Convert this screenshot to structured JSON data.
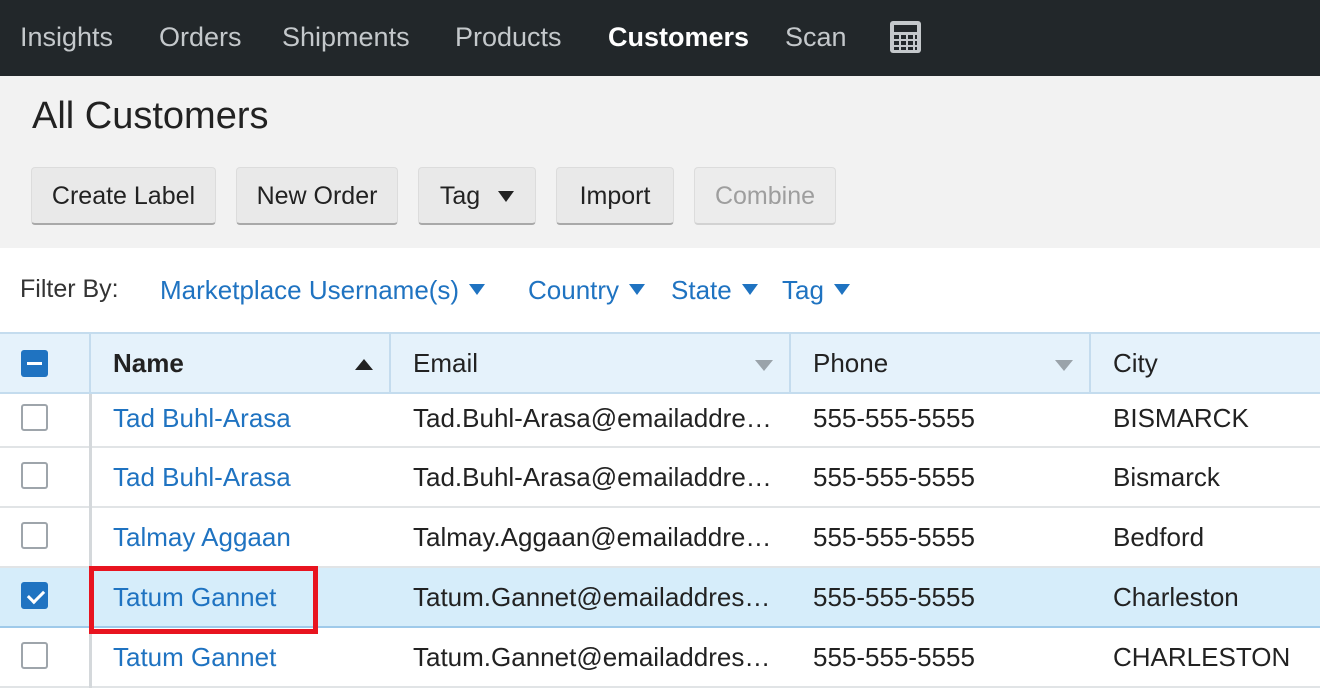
{
  "nav": {
    "items": [
      "Insights",
      "Orders",
      "Shipments",
      "Products",
      "Customers",
      "Scan"
    ],
    "active": "Customers",
    "calculator_icon": "calculator-icon"
  },
  "page": {
    "title": "All Customers"
  },
  "toolbar": {
    "create_label": "Create Label",
    "new_order": "New Order",
    "tag": "Tag",
    "import": "Import",
    "combine": "Combine"
  },
  "filters": {
    "label": "Filter By:",
    "items": [
      "Marketplace Username(s)",
      "Country",
      "State",
      "Tag"
    ]
  },
  "table": {
    "columns": [
      "Name",
      "Email",
      "Phone",
      "City"
    ],
    "sort_column": "Name",
    "sort_direction": "ascending",
    "header_checkbox_state": "indeterminate",
    "rows": [
      {
        "name": "Tad Buhl-Arasa",
        "email": "Tad.Buhl-Arasa@emailaddress.com",
        "phone": "555-555-5555",
        "city": "BISMARCK",
        "checked": false
      },
      {
        "name": "Tad Buhl-Arasa",
        "email": "Tad.Buhl-Arasa@emailaddress.com",
        "phone": "555-555-5555",
        "city": "Bismarck",
        "checked": false
      },
      {
        "name": "Talmay Aggaan",
        "email": "Talmay.Aggaan@emailaddress.com",
        "phone": "555-555-5555",
        "city": "Bedford",
        "checked": false
      },
      {
        "name": "Tatum Gannet",
        "email": "Tatum.Gannet@emailaddress.com",
        "phone": "555-555-5555",
        "city": "Charleston",
        "checked": true
      },
      {
        "name": "Tatum Gannet",
        "email": "Tatum.Gannet@emailaddress.com",
        "phone": "555-555-5555",
        "city": "CHARLESTON",
        "checked": false
      }
    ]
  },
  "colors": {
    "nav_bg": "#22272a",
    "link": "#1f73c1",
    "selected_row": "#d6edfa",
    "highlight": "#e8141f"
  }
}
